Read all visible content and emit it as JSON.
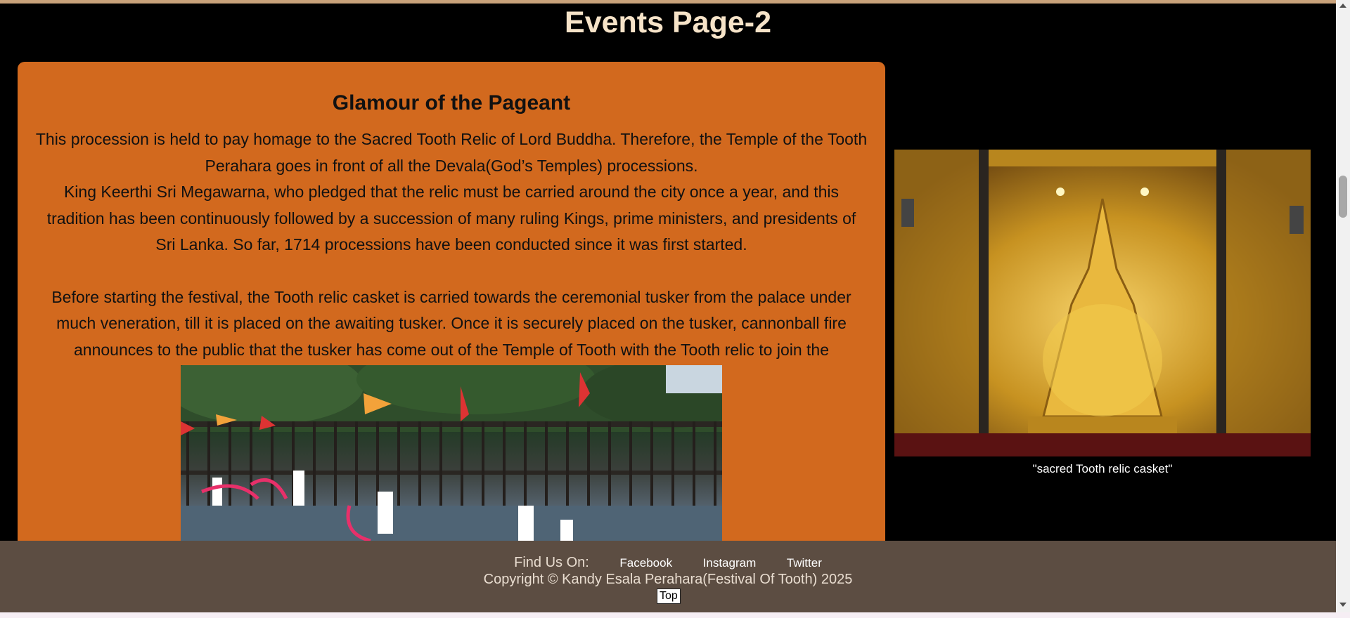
{
  "page": {
    "title": "Events Page-2"
  },
  "article": {
    "heading": "Glamour of the Pageant",
    "paragraph1": "This procession is held to pay homage to the Sacred Tooth Relic of Lord Buddha. Therefore, the Temple of the Tooth Perahara goes in front of all the Devala(God’s Temples) processions.",
    "paragraph2": "King Keerthi Sri Megawarna, who pledged that the relic must be carried around the city once a year, and this tradition has been continuously followed by a succession of many ruling Kings, prime ministers, and presidents of Sri Lanka. So far, 1714 processions have been conducted since it was first started.",
    "paragraph3": "Before starting the festival, the Tooth relic casket is carried towards the ceremonial tusker from the palace under much veneration, till it is placed on the awaiting tusker. Once it is securely placed on the tusker, cannonball fire announces to the public that the tusker has come out of the Temple of Tooth with the Tooth relic to join the procession."
  },
  "side_figure": {
    "caption": "\"sacred Tooth relic casket\""
  },
  "footer": {
    "find_us_label": "Find Us On:",
    "links": [
      "Facebook",
      "Instagram",
      "Twitter"
    ],
    "copyright": "Copyright © Kandy Esala Perahara(Festival Of Tooth) 2025",
    "top_button": "Top"
  },
  "colors": {
    "article_bg": "#d2691e",
    "title_color": "#f6e3c8",
    "footer_bg": "#5c4d42",
    "page_bg": "#000000"
  }
}
